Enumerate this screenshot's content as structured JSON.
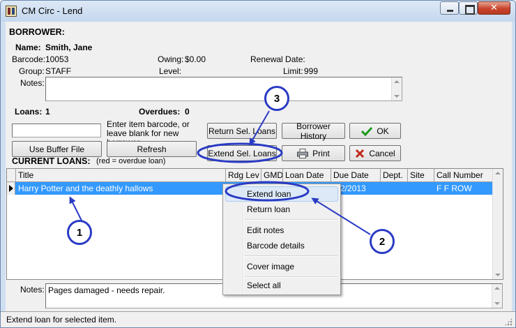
{
  "window": {
    "title": "CM Circ - Lend",
    "close_glyph": "✕"
  },
  "borrower": {
    "section_label": "BORROWER:",
    "name_label": "Name:",
    "name_value": "Smith, Jane",
    "barcode_label": "Barcode:",
    "barcode_value": "10053",
    "owing_label": "Owing:",
    "owing_value": "$0.00",
    "renewal_label": "Renewal Date:",
    "renewal_value": "",
    "group_label": "Group:",
    "group_value": "STAFF",
    "level_label": "Level:",
    "level_value": "",
    "limit_label": "Limit:",
    "limit_value": "999",
    "notes_label": "Notes:",
    "notes_value": ""
  },
  "loans": {
    "loans_label": "Loans:",
    "loans_value": "1",
    "overdues_label": "Overdues:",
    "overdues_value": "0"
  },
  "entry": {
    "barcode_input_value": "",
    "hint": "Enter item barcode, or leave blank for new borrower."
  },
  "buttons": {
    "use_buffer_file": "Use Buffer File",
    "refresh": "Refresh",
    "return_sel_loans": "Return Sel. Loans",
    "extend_sel_loans": "Extend Sel. Loans",
    "borrower_history": "Borrower History",
    "print": "Print",
    "ok": "OK",
    "cancel": "Cancel"
  },
  "current_loans": {
    "heading": "CURRENT LOANS:",
    "legend": "(red = overdue loan)",
    "columns": [
      "Title",
      "Rdg Lev",
      "GMD",
      "Loan Date",
      "Due Date",
      "Dept.",
      "Site",
      "Call Number"
    ],
    "rows": [
      {
        "title": "Harry Potter and the deathly hallows",
        "rdg_lev": "",
        "gmd": "",
        "loan_date": "",
        "due_date": "/12/2013",
        "dept": "",
        "site": "",
        "call_number": "F F ROW"
      }
    ]
  },
  "context_menu": {
    "items": [
      "Extend loan",
      "Return loan",
      "Edit notes",
      "Barcode details",
      "Cover image",
      "Select all"
    ],
    "highlighted": "Extend loan"
  },
  "item_notes": {
    "label": "Notes:",
    "value": "Pages damaged - needs repair."
  },
  "status_bar": {
    "text": "Extend loan for selected item."
  },
  "callouts": [
    "1",
    "2",
    "3"
  ],
  "colors": {
    "selection": "#3399ff",
    "annotation": "#2a3bc4",
    "ok_check": "#1a9a1a",
    "cancel_x": "#c0281a"
  }
}
